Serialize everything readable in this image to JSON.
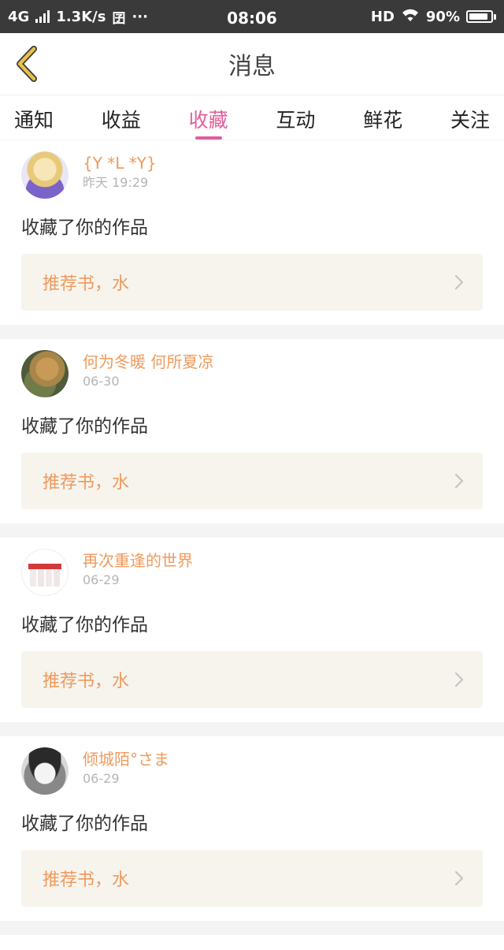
{
  "status": {
    "network": "4G",
    "speed": "1.3K/s",
    "time": "08:06",
    "hd": "HD",
    "battery": "90%",
    "battery_level": 0.9
  },
  "header": {
    "title": "消息"
  },
  "tabs": [
    {
      "label": "通知"
    },
    {
      "label": "收益"
    },
    {
      "label": "收藏",
      "active": true
    },
    {
      "label": "互动"
    },
    {
      "label": "鲜花"
    },
    {
      "label": "关注"
    }
  ],
  "messages": [
    {
      "username": "{Y *L *Y}",
      "time": "昨天 19:29",
      "action": "收藏了你的作品",
      "book": "推荐书，水"
    },
    {
      "username": "何为冬暖 何所夏凉",
      "time": "06-30",
      "action": "收藏了你的作品",
      "book": "推荐书，水"
    },
    {
      "username": "再次重逢的世界",
      "time": "06-29",
      "action": "收藏了你的作品",
      "book": "推荐书，水"
    },
    {
      "username": "倾城陌°さま",
      "time": "06-29",
      "action": "收藏了你的作品",
      "book": "推荐书，水"
    }
  ],
  "colors": {
    "accent": "#e0609a",
    "name": "#ef9a5c",
    "back": "#e6c24c"
  }
}
